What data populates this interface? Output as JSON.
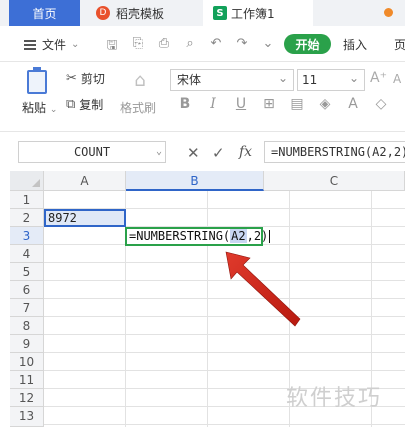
{
  "tabs": {
    "home": "首页",
    "daoke": "稻壳模板",
    "daoke_icon": "D",
    "book": "工作簿1",
    "book_icon": "S"
  },
  "menu": {
    "file": "文件",
    "start": "开始",
    "insert": "插入",
    "page": "页"
  },
  "ribbon": {
    "paste": "粘贴",
    "cut": "剪切",
    "copy": "复制",
    "format_painter": "格式刷",
    "font": "宋体",
    "size": "11"
  },
  "formula_bar": {
    "name_box": "COUNT",
    "fx": "fx",
    "formula": "=NUMBERSTRING(A2,2)"
  },
  "grid": {
    "columns": [
      "A",
      "B",
      "C"
    ],
    "rows": [
      "1",
      "2",
      "3",
      "4",
      "5",
      "6",
      "7",
      "8",
      "9",
      "10",
      "11",
      "12",
      "13"
    ],
    "a2": "8972",
    "b3_prefix": "=NUMBERSTRING(",
    "b3_ref": "A2",
    "b3_suffix": ",2)"
  },
  "colors": {
    "accent_blue": "#2f65c8",
    "accent_green": "#2aa14a",
    "arrow_red": "#d9261c"
  },
  "watermark": "软件技巧"
}
